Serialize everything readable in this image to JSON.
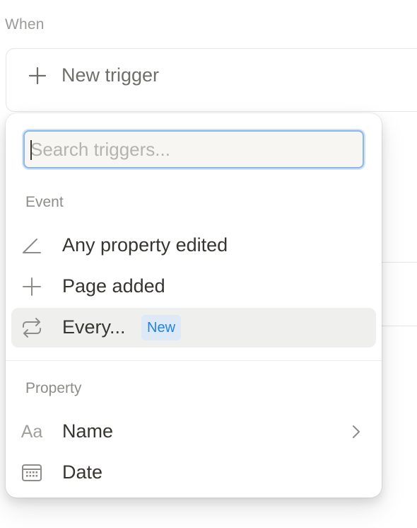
{
  "when_label": "When",
  "trigger": {
    "label": "New trigger",
    "icon": "plus-icon"
  },
  "dropdown": {
    "search": {
      "placeholder": "Search triggers...",
      "value": ""
    },
    "event_section": {
      "title": "Event",
      "items": [
        {
          "label": "Any property edited",
          "icon": "pencil-icon"
        },
        {
          "label": "Page added",
          "icon": "plus-icon"
        },
        {
          "label": "Every...",
          "icon": "repeat-icon",
          "badge": "New",
          "highlighted": true
        }
      ]
    },
    "property_section": {
      "title": "Property",
      "items": [
        {
          "label": "Name",
          "icon": "text-property-icon",
          "icon_text": "Aa",
          "has_submenu": true
        },
        {
          "label": "Date",
          "icon": "calendar-icon"
        }
      ]
    }
  },
  "colors": {
    "accent": "#2383e2",
    "badge_bg": "#dde9f6",
    "focus_ring": "#8bb8e6",
    "hover_bg": "#efefee",
    "text": "#37352f",
    "muted_text": "#9b9a97"
  }
}
